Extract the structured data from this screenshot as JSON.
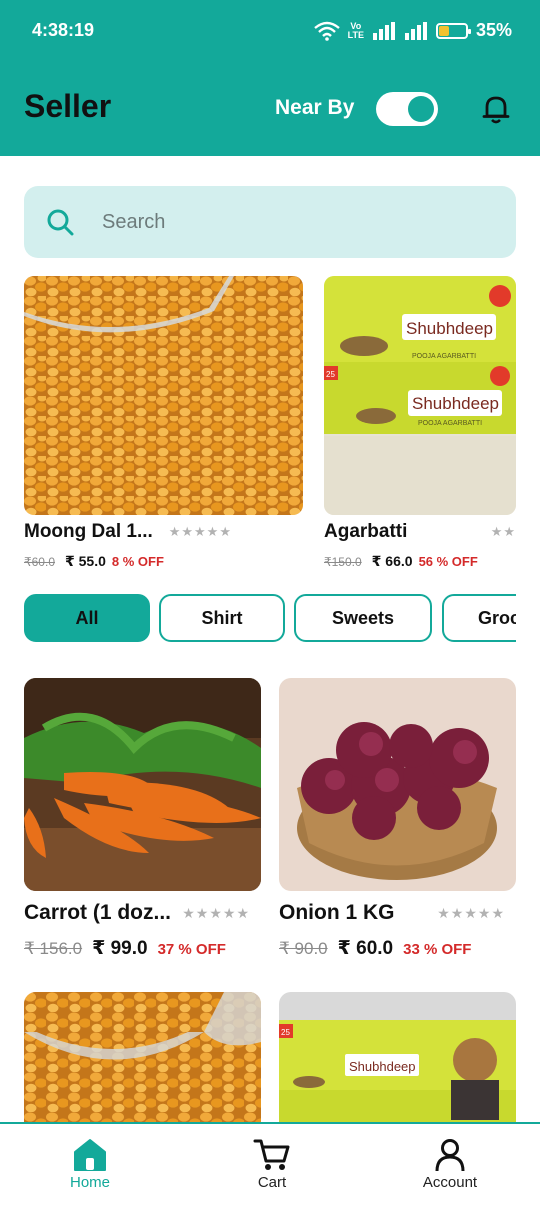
{
  "status_bar": {
    "time": "4:38:19",
    "volte_line1": "Vo",
    "volte_line2": "LTE",
    "battery": "35%",
    "battery_level": 0.35
  },
  "header": {
    "title": "Seller",
    "near_by_label": "Near By",
    "near_by_enabled": true
  },
  "search": {
    "placeholder": "Search"
  },
  "featured": [
    {
      "title": "Moong Dal 1...",
      "rating": "★★★★★",
      "old_price": "₹60.0",
      "price": "₹ 55.0",
      "discount": "8 % OFF"
    },
    {
      "title": "Agarbatti",
      "rating": "★★★★★",
      "old_price": "₹150.0",
      "price": "₹ 66.0",
      "discount": "56 % OFF"
    }
  ],
  "packet": {
    "brand": "Shubhdeep",
    "sub": "POOJA AGARBATTI",
    "count": "25"
  },
  "categories": [
    "All",
    "Shirt",
    "Sweets",
    "Grocery"
  ],
  "products": [
    {
      "title": "Carrot (1 doz...",
      "rating": "★★★★★",
      "old_price": "₹ 156.0",
      "price": "₹ 99.0",
      "discount": "37 % OFF"
    },
    {
      "title": "Onion 1 KG",
      "rating": "★★★★★",
      "old_price": "₹ 90.0",
      "price": "₹ 60.0",
      "discount": "33 % OFF"
    }
  ],
  "nav": {
    "home": "Home",
    "cart": "Cart",
    "account": "Account"
  },
  "colors": {
    "primary": "#13a99a",
    "search_bg": "#d3efee",
    "discount": "#d42a2a"
  }
}
